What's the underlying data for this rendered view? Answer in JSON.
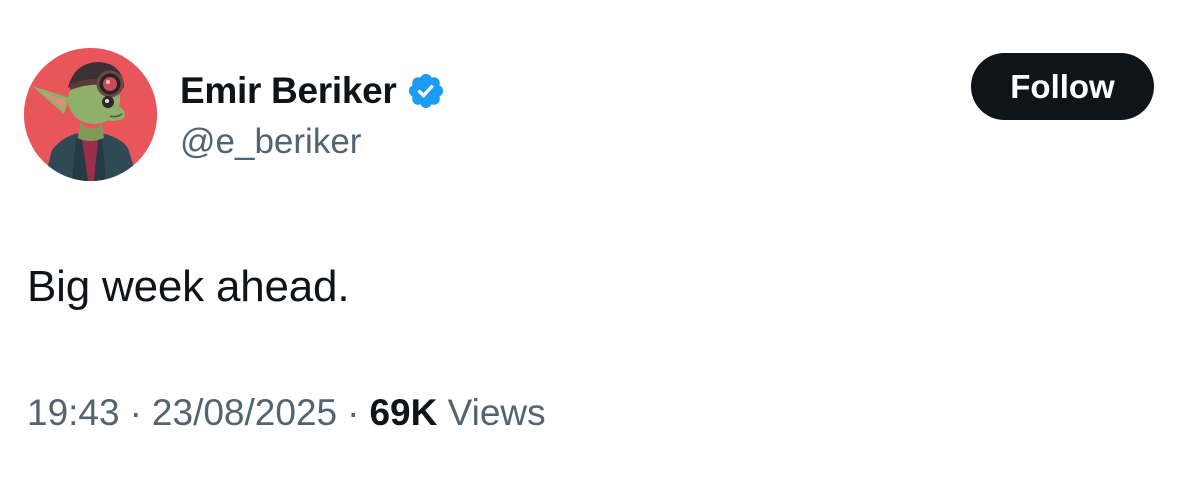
{
  "author": {
    "display_name": "Emir Beriker",
    "handle": "@e_beriker",
    "verified": true,
    "avatar_bg_color": "#e8555a"
  },
  "actions": {
    "follow_label": "Follow"
  },
  "tweet": {
    "text": "Big week ahead."
  },
  "meta": {
    "time": "19:43",
    "separator": "·",
    "date": "23/08/2025",
    "views_count": "69K",
    "views_label": "Views"
  },
  "colors": {
    "text_primary": "#0f1419",
    "text_secondary": "#536471",
    "verified_blue": "#1d9bf0",
    "button_bg": "#0f1419",
    "button_text": "#ffffff"
  },
  "icons": {
    "verified": "verified-badge-icon",
    "avatar": "goblin-pilot-avatar"
  }
}
